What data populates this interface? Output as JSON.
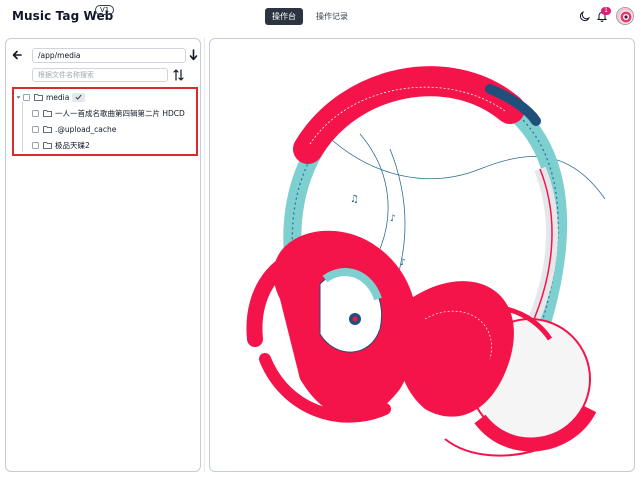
{
  "app": {
    "title": "Music Tag Web",
    "version": "V1"
  },
  "nav": {
    "tabs": [
      {
        "label": "操作台",
        "active": true
      },
      {
        "label": "操作记录",
        "active": false
      }
    ]
  },
  "header": {
    "notification_count": "1",
    "icons": [
      "moon-icon",
      "bell-icon",
      "avatar"
    ]
  },
  "sidebar": {
    "path_value": "/app/media",
    "search_placeholder": "根据文件名称搜索",
    "tree": {
      "root": {
        "label": "media",
        "expanded": true
      },
      "children": [
        {
          "label": "一人一首成名歌曲第四辑第二片 HDCD"
        },
        {
          "label": ".@upload_cache"
        },
        {
          "label": "极品天碟2"
        }
      ]
    }
  },
  "theme": {
    "accent_red": "#f5144a",
    "accent_teal": "#7ecfd0",
    "dark_button": "#2b3440",
    "highlight_border": "#d92b2b"
  }
}
